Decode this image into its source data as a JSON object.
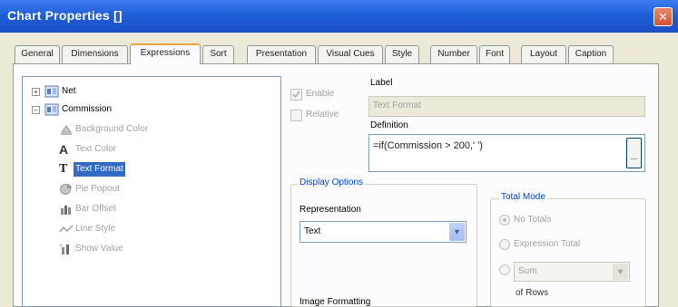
{
  "window": {
    "title": "Chart Properties []",
    "close_icon": "close-icon"
  },
  "tabs": [
    {
      "label": "General"
    },
    {
      "label": "Dimensions"
    },
    {
      "label": "Expressions",
      "active": true
    },
    {
      "label": "Sort"
    },
    {
      "label": "Presentation"
    },
    {
      "label": "Visual Cues"
    },
    {
      "label": "Style"
    },
    {
      "label": "Number"
    },
    {
      "label": "Font"
    },
    {
      "label": "Layout"
    },
    {
      "label": "Caption"
    }
  ],
  "tree": {
    "items": [
      {
        "label": "Net",
        "expander": "+",
        "icon": "expression-icon"
      },
      {
        "label": "Commission",
        "expander": "-",
        "icon": "expression-icon"
      },
      {
        "label": "Background Color",
        "icon": "background-color-icon"
      },
      {
        "label": "Text Color",
        "icon": "text-color-icon"
      },
      {
        "label": "Text Format",
        "icon": "text-format-icon",
        "selected": true
      },
      {
        "label": "Pie Popout",
        "icon": "pie-popout-icon"
      },
      {
        "label": "Bar Offset",
        "icon": "bar-offset-icon"
      },
      {
        "label": "Line Style",
        "icon": "line-style-icon"
      },
      {
        "label": "Show Value",
        "icon": "show-value-icon"
      }
    ]
  },
  "options": {
    "enable_label": "Enable",
    "relative_label": "Relative"
  },
  "label_section": {
    "caption": "Label",
    "value": "Text Format"
  },
  "definition_section": {
    "caption": "Definition",
    "value": "=if(Commission > 200,'   ')",
    "button_label": "..."
  },
  "display_options": {
    "title": "Display Options",
    "representation_label": "Representation",
    "representation_value": "Text",
    "image_formatting_label": "Image Formatting"
  },
  "total_mode": {
    "title": "Total Mode",
    "no_totals": "No Totals",
    "expression_total": "Expression Total",
    "sum_value": "Sum",
    "of_rows": "of Rows"
  },
  "colors": {
    "titlebar": "#1f5fd8",
    "selection": "#316ac5",
    "tab_highlight": "#e8a53c"
  }
}
